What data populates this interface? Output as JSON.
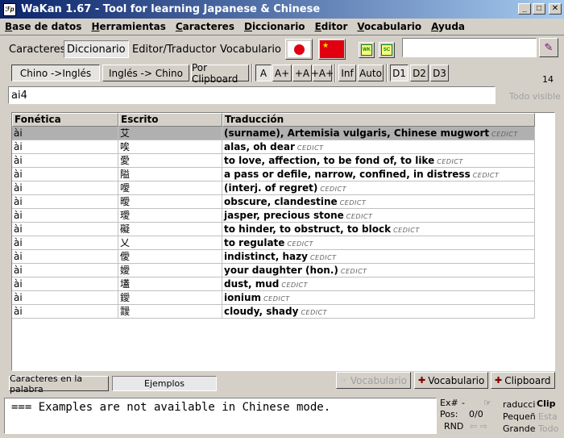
{
  "window": {
    "title": "WaKan 1.67 - Tool for learning Japanese & Chinese",
    "icon_text": "ℱp",
    "minimize": "_",
    "maximize": "□",
    "close": "✕"
  },
  "menu": [
    "Base de datos",
    "Herramientas",
    "Caracteres",
    "Diccionario",
    "Editor",
    "Vocabulario",
    "Ayuda"
  ],
  "toolbar": {
    "tabs": [
      "Caracteres",
      "Diccionario",
      "Editor/Traductor",
      "Vocabulario"
    ],
    "active_tab": "Diccionario",
    "icon_btn_1": "WK",
    "icon_btn_2": "SC",
    "search_value": "",
    "brush": "✎"
  },
  "mode_buttons": {
    "chino_ingles": "Chino ->Inglés",
    "ingles_chino": "Inglés -> Chino",
    "clipboard": "Por Clipboard",
    "a": "A",
    "a_plus": "A+",
    "plus_a": "+A",
    "plus_a_plus": "+A+",
    "inf": "Inf",
    "auto": "Auto",
    "d1": "D1",
    "d2": "D2",
    "d3": "D3"
  },
  "result_count": "14",
  "query": {
    "value": "ai4"
  },
  "todo_visible": "Todo visible",
  "table": {
    "headers": [
      "Fonética",
      "Escrito",
      "Traducción"
    ],
    "rows": [
      {
        "phonetic": "ài",
        "written": "艾",
        "translation": "(surname), Artemisia vulgaris, Chinese mugwort",
        "dict": "CEDICT"
      },
      {
        "phonetic": "ài",
        "written": "唉",
        "translation": "alas, oh dear",
        "dict": "CEDICT"
      },
      {
        "phonetic": "ài",
        "written": "愛",
        "translation": "to love, affection, to be fond of, to like",
        "dict": "CEDICT"
      },
      {
        "phonetic": "ài",
        "written": "隘",
        "translation": "a pass or defile, narrow, confined, in distress",
        "dict": "CEDICT"
      },
      {
        "phonetic": "ài",
        "written": "噯",
        "translation": "(interj. of regret)",
        "dict": "CEDICT"
      },
      {
        "phonetic": "ài",
        "written": "曖",
        "translation": "obscure, clandestine",
        "dict": "CEDICT"
      },
      {
        "phonetic": "ài",
        "written": "璦",
        "translation": "jasper, precious stone",
        "dict": "CEDICT"
      },
      {
        "phonetic": "ài",
        "written": "礙",
        "translation": "to hinder, to obstruct, to block",
        "dict": "CEDICT"
      },
      {
        "phonetic": "ài",
        "written": "乂",
        "translation": "to regulate",
        "dict": "CEDICT"
      },
      {
        "phonetic": "ài",
        "written": "僾",
        "translation": "indistinct, hazy",
        "dict": "CEDICT"
      },
      {
        "phonetic": "ài",
        "written": "嬡",
        "translation": "your daughter (hon.)",
        "dict": "CEDICT"
      },
      {
        "phonetic": "ài",
        "written": "壒",
        "translation": "dust, mud",
        "dict": "CEDICT"
      },
      {
        "phonetic": "ài",
        "written": "鑀",
        "translation": "ionium",
        "dict": "CEDICT"
      },
      {
        "phonetic": "ài",
        "written": "靉",
        "translation": "cloudy, shady",
        "dict": "CEDICT"
      }
    ]
  },
  "bottom_tabs": [
    "Caracteres en la palabra",
    "Ejemplos"
  ],
  "bottom_buttons": {
    "vocab_disabled": "Vocabulario",
    "vocab": "Vocabulario",
    "clipboard": "Clipboard"
  },
  "examples_text": "=== Examples are not available in Chinese mode.",
  "examples_panel": {
    "ex_label": "Ex#",
    "ex_value": "-",
    "pos_label": "Pos:",
    "pos_value": "0/0",
    "rnd": "RND",
    "nav": "⇦ ⇨",
    "traduccion": "raducci",
    "pequeno": "Pequeñ",
    "grande": "Grande",
    "clip": "Clip",
    "esta": "Esta",
    "todo": "Todo"
  }
}
